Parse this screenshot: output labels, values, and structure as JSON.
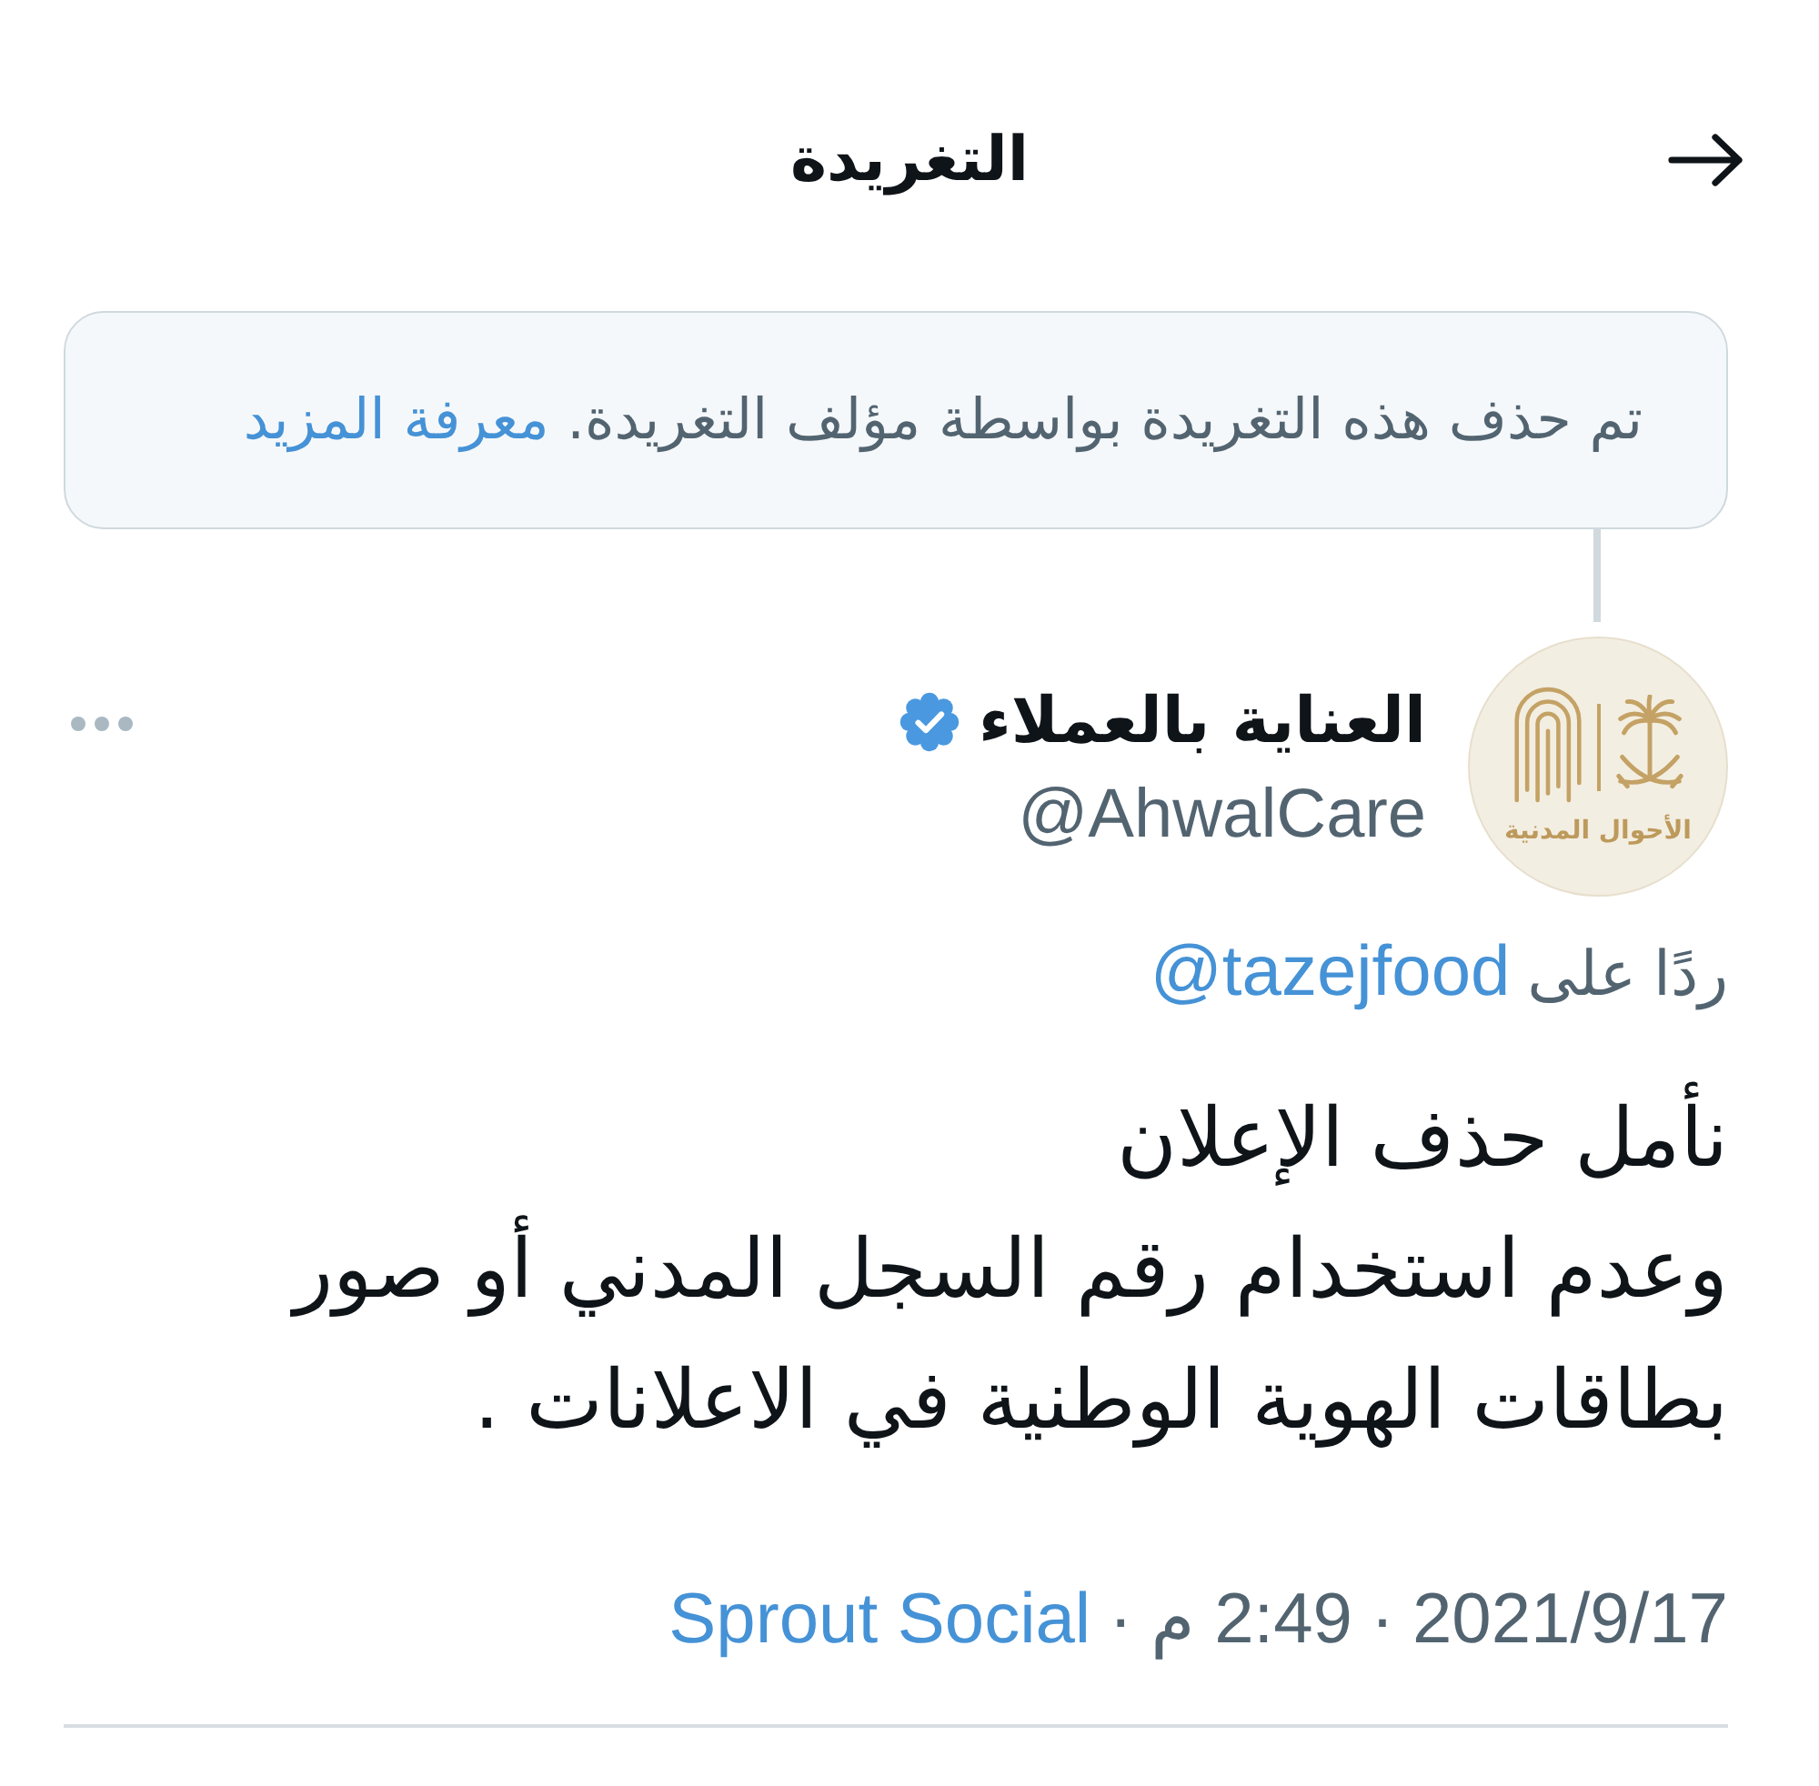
{
  "header": {
    "title": "التغريدة"
  },
  "notice": {
    "text": "تم حذف هذه التغريدة بواسطة مؤلف التغريدة.",
    "link": "معرفة المزيد"
  },
  "tweet": {
    "author": {
      "name": "العناية بالعملاء",
      "verified": true,
      "handle": "@AhwalCare",
      "avatar_logo_text": "الأحوال المدنية"
    },
    "reply_to": {
      "label": "ردًا على",
      "handle": "@tazejfood"
    },
    "text": "نأمل حذف الإعلان\nوعدم استخدام رقم السجل المدني أو صور\nبطاقات الهوية الوطنية في الاعلانات .",
    "meta": [
      {
        "kind": "text",
        "text": "2021/9/17"
      },
      {
        "kind": "separator",
        "text": "·"
      },
      {
        "kind": "text",
        "text": "2:49 م"
      },
      {
        "kind": "separator",
        "text": "·"
      },
      {
        "kind": "link",
        "text": "Sprout Social"
      }
    ]
  }
}
